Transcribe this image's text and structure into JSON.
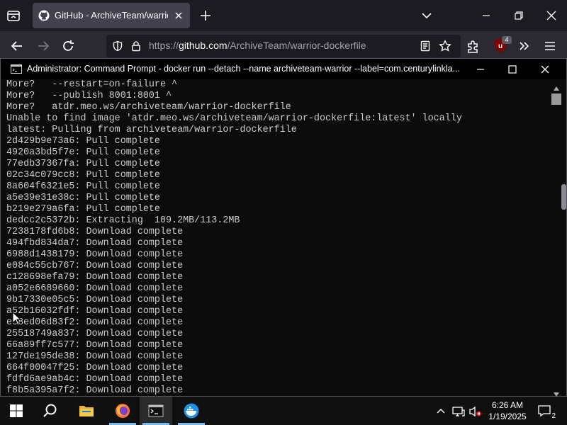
{
  "browser": {
    "tab": {
      "title": "GitHub - ArchiveTeam/warrior-d"
    },
    "url": {
      "prefix": "https://",
      "host": "github.com",
      "path": "/ArchiveTeam/warrior-dockerfile"
    },
    "extension_badge": "4"
  },
  "cmd": {
    "title": "Administrator: Command Prompt - docker  run --detach  --name archiveteam-warrior  --label=com.centurylinkla...",
    "lines": [
      "More?   --restart=on-failure ^",
      "More?   --publish 8001:8001 ^",
      "More?   atdr.meo.ws/archiveteam/warrior-dockerfile",
      "Unable to find image 'atdr.meo.ws/archiveteam/warrior-dockerfile:latest' locally",
      "latest: Pulling from archiveteam/warrior-dockerfile",
      "2d429b9e73a6: Pull complete",
      "4920a3bd5f7e: Pull complete",
      "77edb37367fa: Pull complete",
      "02c34c079cc8: Pull complete",
      "8a604f6321e5: Pull complete",
      "a5e39e31e38c: Pull complete",
      "b219e279a6fa: Pull complete",
      "dedcc2c5372b: Extracting  109.2MB/113.2MB",
      "7238178fd6b8: Download complete",
      "494fbd834da7: Download complete",
      "6988d1438179: Download complete",
      "e084c55cb767: Download complete",
      "c128698efa79: Download complete",
      "a052e6689660: Download complete",
      "9b17330e05c5: Download complete",
      "a52b16032fdf: Download complete",
      "ec8ed06d83f2: Download complete",
      "25518749a837: Download complete",
      "66a89ff7c577: Download complete",
      "127de195de38: Download complete",
      "664f00047f25: Download complete",
      "fdfd6ae9ab4c: Download complete",
      "f8b5a395a7f2: Download complete"
    ]
  },
  "taskbar": {
    "time": "6:26 AM",
    "date": "1/19/2025",
    "notification_count": "2"
  }
}
